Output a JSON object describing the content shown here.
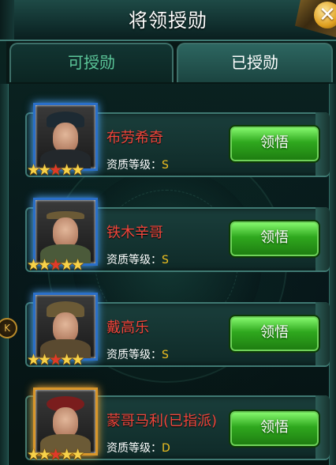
{
  "header": {
    "title": "将领授勋"
  },
  "tabs": [
    {
      "label": "可授勋",
      "active": false
    },
    {
      "label": "已授勋",
      "active": true
    }
  ],
  "side_button": {
    "label": "K"
  },
  "rank_label": "资质等级：",
  "generals": [
    {
      "name": "布劳希奇",
      "rank": "S",
      "stars": 5,
      "button": "领悟",
      "frame": "blue",
      "icon": "officer-portrait-icon"
    },
    {
      "name": "铁木辛哥",
      "rank": "S",
      "stars": 5,
      "button": "领悟",
      "frame": "blue",
      "icon": "marshal-portrait-icon"
    },
    {
      "name": "戴高乐",
      "rank": "S",
      "stars": 5,
      "button": "领悟",
      "frame": "blue",
      "icon": "general-kepi-portrait-icon"
    },
    {
      "name": "蒙哥马利(已指派)",
      "rank": "D",
      "stars": 5,
      "button": "领悟",
      "frame": "gold",
      "icon": "beret-officer-portrait-icon"
    }
  ],
  "colors": {
    "name": "#f0463c",
    "rank_value": "#f0c020",
    "button": "#2fa81e",
    "active_tab": "#2d6660"
  }
}
